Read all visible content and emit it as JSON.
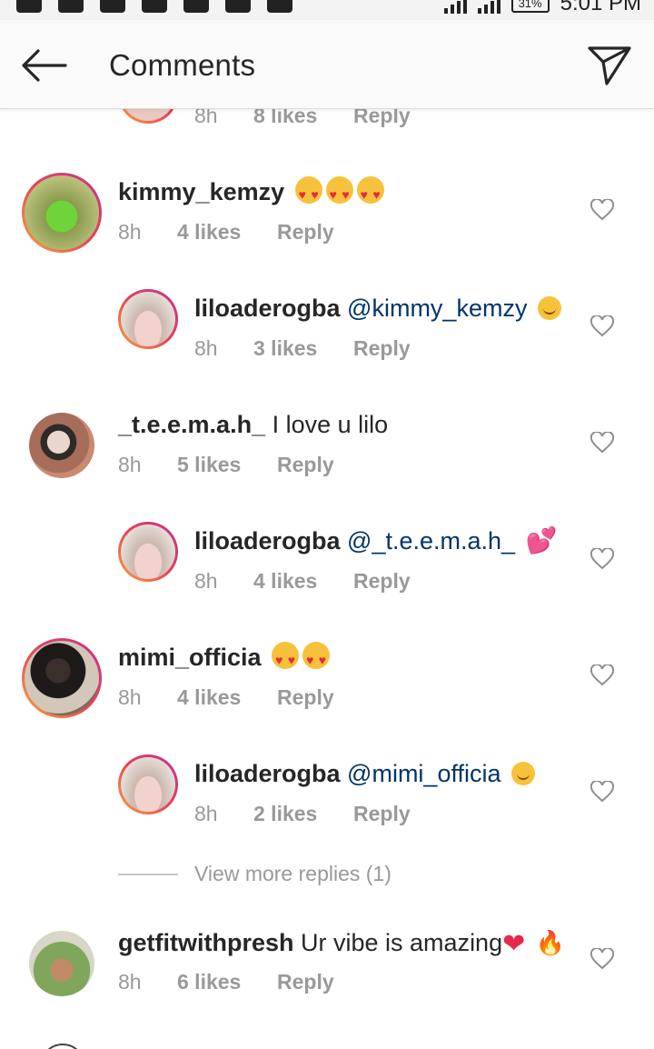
{
  "status_bar": {
    "battery": "31%",
    "time": "5:01 PM"
  },
  "header": {
    "title": "Comments"
  },
  "top_partial": {
    "time": "8h",
    "likes": "8 likes",
    "reply": "Reply"
  },
  "comments": [
    {
      "username": "kimmy_kemzy",
      "text": "",
      "time": "8h",
      "likes": "4 likes",
      "reply": "Reply",
      "emoji": [
        "heart-eyes",
        "heart-eyes",
        "heart-eyes"
      ]
    },
    {
      "username": "liloaderogba",
      "mention": "@kimmy_kemzy",
      "time": "8h",
      "likes": "3 likes",
      "reply": "Reply",
      "emoji": [
        "smile"
      ]
    },
    {
      "username": "_t.e.e.m.a.h_",
      "text": "I love u lilo",
      "time": "8h",
      "likes": "5 likes",
      "reply": "Reply"
    },
    {
      "username": "liloaderogba",
      "mention": "@_t.e.e.m.a.h_",
      "time": "8h",
      "likes": "4 likes",
      "reply": "Reply",
      "emoji": [
        "two-hearts"
      ]
    },
    {
      "username": "mimi_officia",
      "text": "",
      "time": "8h",
      "likes": "4 likes",
      "reply": "Reply",
      "emoji": [
        "heart-eyes",
        "heart-eyes"
      ]
    },
    {
      "username": "liloaderogba",
      "mention": "@mimi_officia",
      "time": "8h",
      "likes": "2 likes",
      "reply": "Reply",
      "emoji": [
        "smile"
      ]
    },
    {
      "username": "getfitwithpresh",
      "text": "Ur vibe is amazing",
      "time": "8h",
      "likes": "6 likes",
      "reply": "Reply",
      "emoji": [
        "red-heart",
        "fire"
      ]
    }
  ],
  "view_more_replies": "View more replies (1)",
  "colors": {
    "mention": "#003569",
    "meta": "#999999",
    "ring_start": "#f9a53a",
    "ring_end": "#c1358f"
  }
}
